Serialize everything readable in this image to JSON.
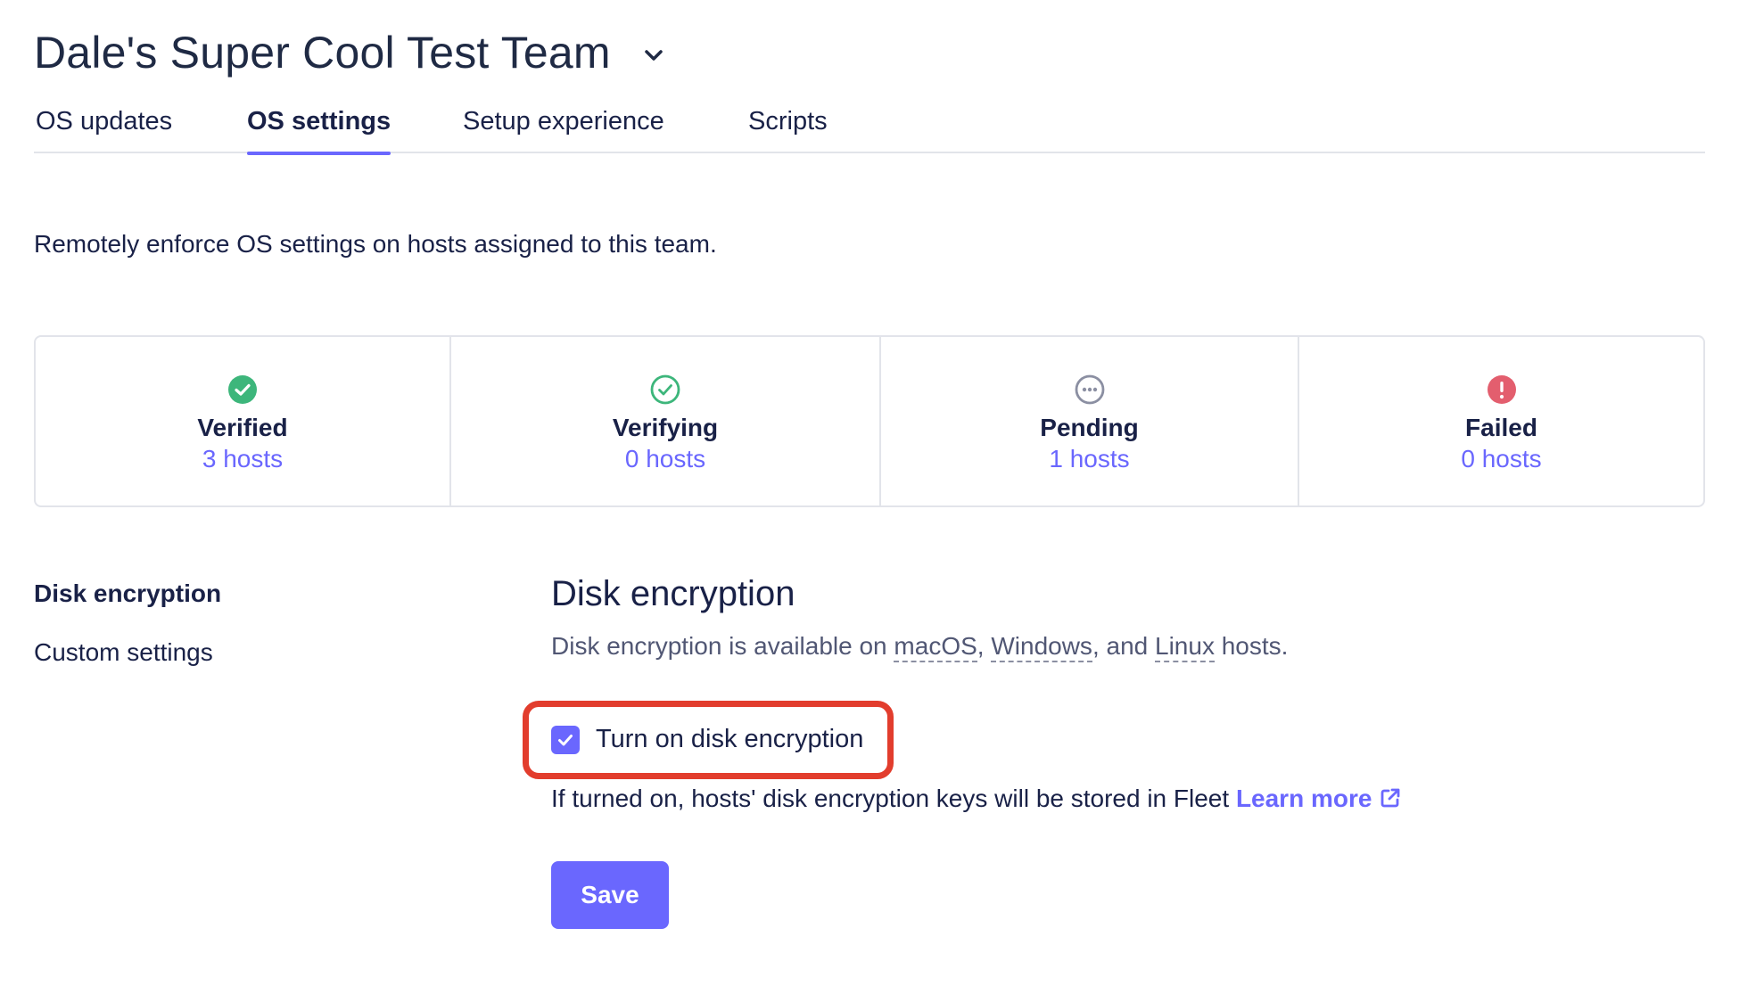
{
  "header": {
    "team_name": "Dale's Super Cool Test Team",
    "dropdown_icon": "chevron-down-icon"
  },
  "tabs": [
    {
      "label": "OS updates",
      "active": false
    },
    {
      "label": "OS settings",
      "active": true
    },
    {
      "label": "Setup experience",
      "active": false
    },
    {
      "label": "Scripts",
      "active": false
    }
  ],
  "intro": "Remotely enforce OS settings on hosts assigned to this team.",
  "status": [
    {
      "label": "Verified",
      "count": "3 hosts",
      "icon": "check-circle-filled-icon",
      "color": "#3db67b"
    },
    {
      "label": "Verifying",
      "count": "0 hosts",
      "icon": "check-circle-outline-icon",
      "color": "#3db67b"
    },
    {
      "label": "Pending",
      "count": "1 hosts",
      "icon": "pending-dots-icon",
      "color": "#8b8fa2"
    },
    {
      "label": "Failed",
      "count": "0 hosts",
      "icon": "error-icon",
      "color": "#e35e6e"
    }
  ],
  "side_nav": [
    {
      "label": "Disk encryption",
      "active": true
    },
    {
      "label": "Custom settings",
      "active": false
    }
  ],
  "panel": {
    "title": "Disk encryption",
    "desc_prefix": "Disk encryption is available on ",
    "os_macos": "macOS",
    "sep1": ", ",
    "os_windows": "Windows",
    "sep2": ", and ",
    "os_linux": "Linux",
    "desc_suffix": " hosts.",
    "checkbox_label": "Turn on disk encryption",
    "checkbox_checked": true,
    "helper_text": "If turned on, hosts' disk encryption keys will be stored in Fleet ",
    "learn_more": "Learn more",
    "save_label": "Save"
  },
  "colors": {
    "accent": "#6a67fe",
    "highlight": "#e23d2d",
    "text": "#192147"
  }
}
